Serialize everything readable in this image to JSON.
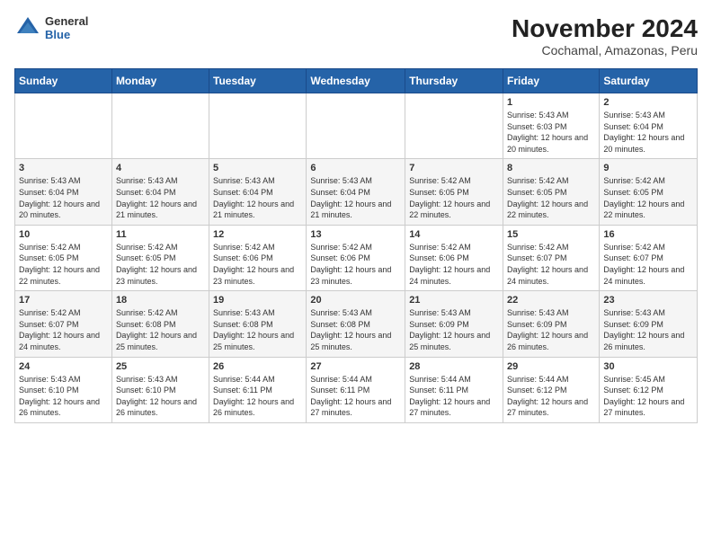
{
  "header": {
    "logo": {
      "general": "General",
      "blue": "Blue"
    },
    "title": "November 2024",
    "subtitle": "Cochamal, Amazonas, Peru"
  },
  "weekdays": [
    "Sunday",
    "Monday",
    "Tuesday",
    "Wednesday",
    "Thursday",
    "Friday",
    "Saturday"
  ],
  "weeks": [
    [
      {
        "day": "",
        "info": ""
      },
      {
        "day": "",
        "info": ""
      },
      {
        "day": "",
        "info": ""
      },
      {
        "day": "",
        "info": ""
      },
      {
        "day": "",
        "info": ""
      },
      {
        "day": "1",
        "info": "Sunrise: 5:43 AM\nSunset: 6:03 PM\nDaylight: 12 hours and 20 minutes."
      },
      {
        "day": "2",
        "info": "Sunrise: 5:43 AM\nSunset: 6:04 PM\nDaylight: 12 hours and 20 minutes."
      }
    ],
    [
      {
        "day": "3",
        "info": "Sunrise: 5:43 AM\nSunset: 6:04 PM\nDaylight: 12 hours and 20 minutes."
      },
      {
        "day": "4",
        "info": "Sunrise: 5:43 AM\nSunset: 6:04 PM\nDaylight: 12 hours and 21 minutes."
      },
      {
        "day": "5",
        "info": "Sunrise: 5:43 AM\nSunset: 6:04 PM\nDaylight: 12 hours and 21 minutes."
      },
      {
        "day": "6",
        "info": "Sunrise: 5:43 AM\nSunset: 6:04 PM\nDaylight: 12 hours and 21 minutes."
      },
      {
        "day": "7",
        "info": "Sunrise: 5:42 AM\nSunset: 6:05 PM\nDaylight: 12 hours and 22 minutes."
      },
      {
        "day": "8",
        "info": "Sunrise: 5:42 AM\nSunset: 6:05 PM\nDaylight: 12 hours and 22 minutes."
      },
      {
        "day": "9",
        "info": "Sunrise: 5:42 AM\nSunset: 6:05 PM\nDaylight: 12 hours and 22 minutes."
      }
    ],
    [
      {
        "day": "10",
        "info": "Sunrise: 5:42 AM\nSunset: 6:05 PM\nDaylight: 12 hours and 22 minutes."
      },
      {
        "day": "11",
        "info": "Sunrise: 5:42 AM\nSunset: 6:05 PM\nDaylight: 12 hours and 23 minutes."
      },
      {
        "day": "12",
        "info": "Sunrise: 5:42 AM\nSunset: 6:06 PM\nDaylight: 12 hours and 23 minutes."
      },
      {
        "day": "13",
        "info": "Sunrise: 5:42 AM\nSunset: 6:06 PM\nDaylight: 12 hours and 23 minutes."
      },
      {
        "day": "14",
        "info": "Sunrise: 5:42 AM\nSunset: 6:06 PM\nDaylight: 12 hours and 24 minutes."
      },
      {
        "day": "15",
        "info": "Sunrise: 5:42 AM\nSunset: 6:07 PM\nDaylight: 12 hours and 24 minutes."
      },
      {
        "day": "16",
        "info": "Sunrise: 5:42 AM\nSunset: 6:07 PM\nDaylight: 12 hours and 24 minutes."
      }
    ],
    [
      {
        "day": "17",
        "info": "Sunrise: 5:42 AM\nSunset: 6:07 PM\nDaylight: 12 hours and 24 minutes."
      },
      {
        "day": "18",
        "info": "Sunrise: 5:42 AM\nSunset: 6:08 PM\nDaylight: 12 hours and 25 minutes."
      },
      {
        "day": "19",
        "info": "Sunrise: 5:43 AM\nSunset: 6:08 PM\nDaylight: 12 hours and 25 minutes."
      },
      {
        "day": "20",
        "info": "Sunrise: 5:43 AM\nSunset: 6:08 PM\nDaylight: 12 hours and 25 minutes."
      },
      {
        "day": "21",
        "info": "Sunrise: 5:43 AM\nSunset: 6:09 PM\nDaylight: 12 hours and 25 minutes."
      },
      {
        "day": "22",
        "info": "Sunrise: 5:43 AM\nSunset: 6:09 PM\nDaylight: 12 hours and 26 minutes."
      },
      {
        "day": "23",
        "info": "Sunrise: 5:43 AM\nSunset: 6:09 PM\nDaylight: 12 hours and 26 minutes."
      }
    ],
    [
      {
        "day": "24",
        "info": "Sunrise: 5:43 AM\nSunset: 6:10 PM\nDaylight: 12 hours and 26 minutes."
      },
      {
        "day": "25",
        "info": "Sunrise: 5:43 AM\nSunset: 6:10 PM\nDaylight: 12 hours and 26 minutes."
      },
      {
        "day": "26",
        "info": "Sunrise: 5:44 AM\nSunset: 6:11 PM\nDaylight: 12 hours and 26 minutes."
      },
      {
        "day": "27",
        "info": "Sunrise: 5:44 AM\nSunset: 6:11 PM\nDaylight: 12 hours and 27 minutes."
      },
      {
        "day": "28",
        "info": "Sunrise: 5:44 AM\nSunset: 6:11 PM\nDaylight: 12 hours and 27 minutes."
      },
      {
        "day": "29",
        "info": "Sunrise: 5:44 AM\nSunset: 6:12 PM\nDaylight: 12 hours and 27 minutes."
      },
      {
        "day": "30",
        "info": "Sunrise: 5:45 AM\nSunset: 6:12 PM\nDaylight: 12 hours and 27 minutes."
      }
    ]
  ]
}
